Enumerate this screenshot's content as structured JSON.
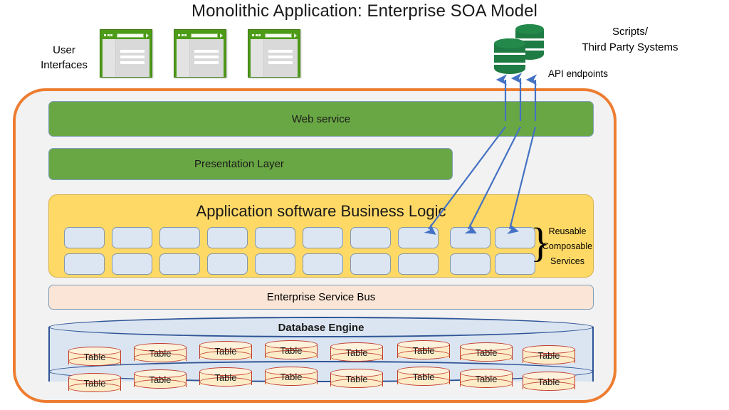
{
  "title": "Monolithic Application: Enterprise SOA Model",
  "user_interfaces": {
    "label": "User\nInterfaces",
    "label_line1": "User",
    "label_line2": "Interfaces",
    "windows": [
      {
        "name": "browser-window-1"
      },
      {
        "name": "browser-window-2"
      },
      {
        "name": "browser-window-3"
      }
    ]
  },
  "external": {
    "database_icon": "database-stack-icon",
    "scripts_label_line1": "Scripts/",
    "scripts_label_line2": "Third Party Systems",
    "api_endpoints_label": "API endpoints",
    "arrow_count": 3
  },
  "monolith": {
    "web_service": "Web service",
    "presentation_layer": "Presentation Layer",
    "business_logic": {
      "title": "Application software Business Logic",
      "service_box_count_per_row": 10,
      "row_count": 2,
      "brace_glyph": "}",
      "brace_label_line1": "Reusable",
      "brace_label_line2": "Composable",
      "brace_label_line3": "Services"
    },
    "enterprise_service_bus": "Enterprise Service Bus",
    "database_engine": {
      "title": "Database Engine",
      "table_label": "Table",
      "tables_per_row": 8,
      "row_count": 2
    }
  },
  "colors": {
    "container_border": "#ed7d31",
    "container_fill": "#f2f2f2",
    "green_layer": "#69a744",
    "business_logic_fill": "#ffd966",
    "service_box_fill": "#dce6f2",
    "esb_fill": "#fbe5d6",
    "db_engine_fill": "#dbe5f1",
    "db_engine_border": "#2e5496",
    "table_fill": "#fdecc8",
    "table_border": "#c0392b",
    "arrow": "#4472c4",
    "external_db": "#1e7b43",
    "ui_window": "#4e9a19"
  }
}
